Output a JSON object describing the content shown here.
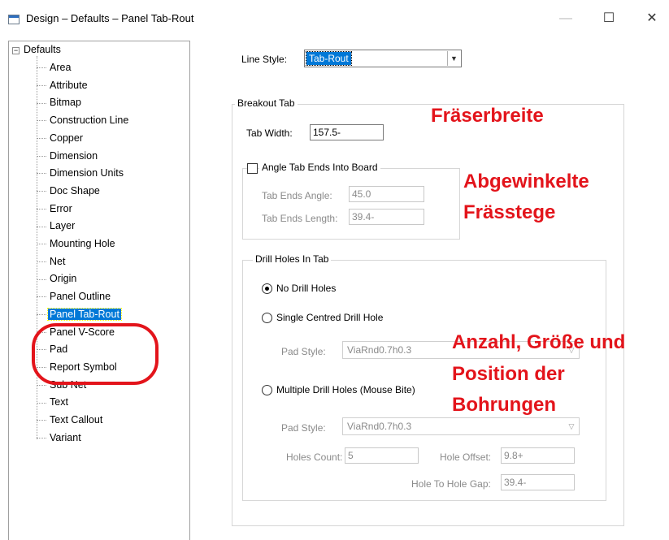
{
  "window": {
    "title": "Design – Defaults – Panel Tab-Rout",
    "minimize_glyph": "—",
    "maximize_glyph": "☐",
    "close_glyph": "✕"
  },
  "tree": {
    "root_label": "Defaults",
    "expander_glyph": "−",
    "items": [
      {
        "label": "Area"
      },
      {
        "label": "Attribute"
      },
      {
        "label": "Bitmap"
      },
      {
        "label": "Construction Line"
      },
      {
        "label": "Copper"
      },
      {
        "label": "Dimension"
      },
      {
        "label": "Dimension Units"
      },
      {
        "label": "Doc Shape"
      },
      {
        "label": "Error"
      },
      {
        "label": "Layer"
      },
      {
        "label": "Mounting Hole"
      },
      {
        "label": "Net"
      },
      {
        "label": "Origin"
      },
      {
        "label": "Panel Outline"
      },
      {
        "label": "Panel Tab-Rout",
        "selected": true
      },
      {
        "label": "Panel V-Score"
      },
      {
        "label": "Pad"
      },
      {
        "label": "Report Symbol"
      },
      {
        "label": "Sub Net"
      },
      {
        "label": "Text"
      },
      {
        "label": "Text Callout"
      },
      {
        "label": "Variant"
      }
    ]
  },
  "form": {
    "line_style": {
      "label": "Line Style:",
      "value": "Tab-Rout"
    },
    "breakout_tab": {
      "title": "Breakout Tab",
      "tab_width": {
        "label": "Tab Width:",
        "value": "157.5-"
      },
      "angle_tab": {
        "checkbox_label": "Angle Tab Ends Into Board",
        "checked": false,
        "ends_angle": {
          "label": "Tab Ends Angle:",
          "value": "45.0"
        },
        "ends_length": {
          "label": "Tab Ends Length:",
          "value": "39.4-"
        }
      },
      "drill_holes": {
        "title": "Drill Holes In Tab",
        "no_drill_label": "No Drill Holes",
        "single_label": "Single Centred Drill Hole",
        "single_pad_style": {
          "label": "Pad Style:",
          "value": "ViaRnd0.7h0.3"
        },
        "multiple_label": "Multiple Drill Holes (Mouse Bite)",
        "multiple_pad_style": {
          "label": "Pad Style:",
          "value": "ViaRnd0.7h0.3"
        },
        "holes_count": {
          "label": "Holes Count:",
          "value": "5"
        },
        "hole_offset": {
          "label": "Hole Offset:",
          "value": "9.8+"
        },
        "hole_gap": {
          "label": "Hole To Hole Gap:",
          "value": "39.4-"
        },
        "selected_option": "no_drill"
      }
    }
  },
  "annotations": {
    "cutter_width": "Fräserbreite",
    "angled_tabs_line1": "Abgewinkelte",
    "angled_tabs_line2": "Frässtege",
    "holes_line1": "Anzahl, Größe und",
    "holes_line2": "Position der",
    "holes_line3": "Bohrungen",
    "color": "#e3141b"
  }
}
